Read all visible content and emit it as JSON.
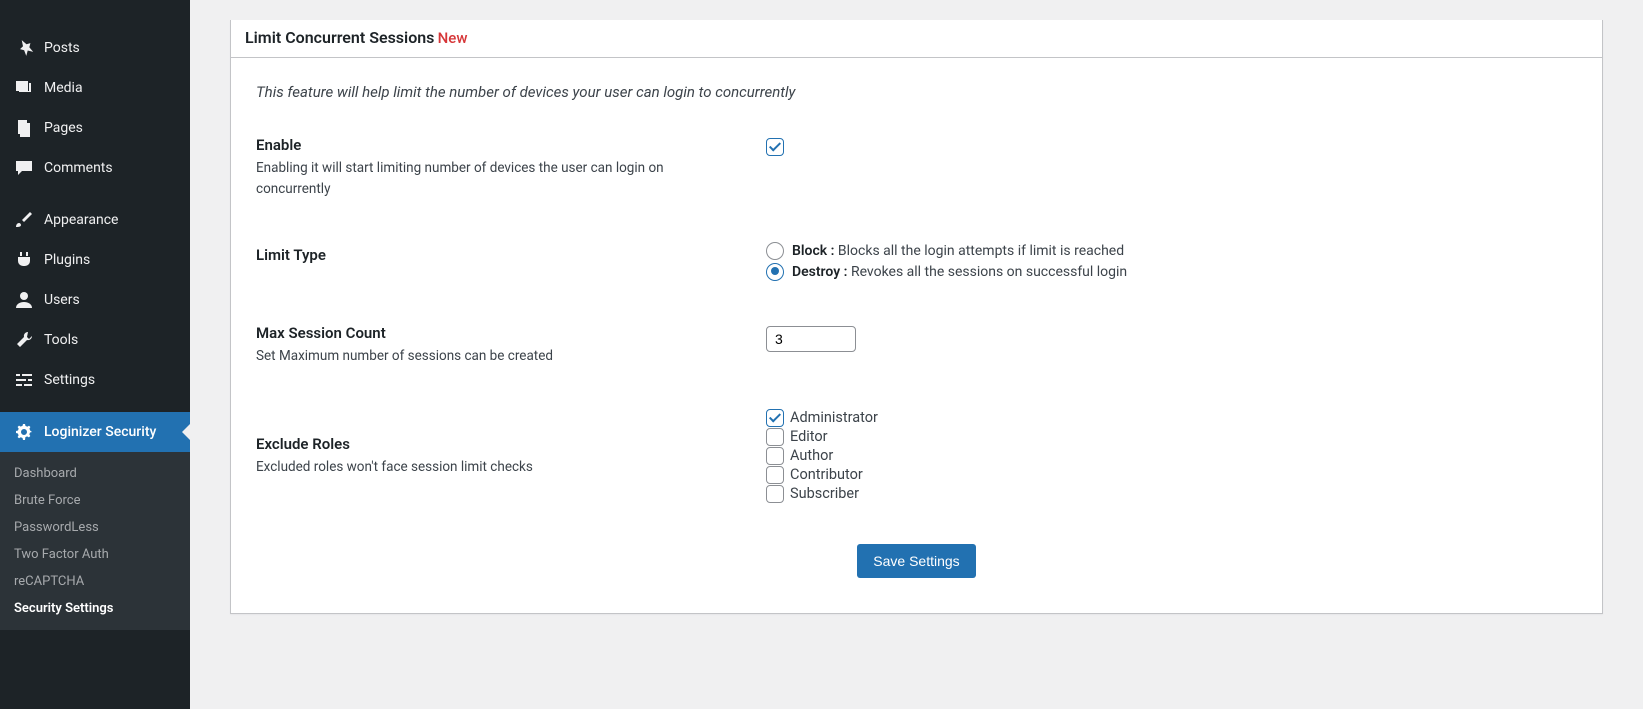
{
  "sidebar": {
    "items": [
      {
        "label": "Posts",
        "icon": "pin"
      },
      {
        "label": "Media",
        "icon": "media"
      },
      {
        "label": "Pages",
        "icon": "pages"
      },
      {
        "label": "Comments",
        "icon": "comment"
      },
      {
        "label": "Appearance",
        "icon": "brush"
      },
      {
        "label": "Plugins",
        "icon": "plug"
      },
      {
        "label": "Users",
        "icon": "user"
      },
      {
        "label": "Tools",
        "icon": "wrench"
      },
      {
        "label": "Settings",
        "icon": "sliders"
      },
      {
        "label": "Loginizer Security",
        "icon": "gear",
        "active": true
      }
    ],
    "submenu": [
      {
        "label": "Dashboard"
      },
      {
        "label": "Brute Force"
      },
      {
        "label": "PasswordLess"
      },
      {
        "label": "Two Factor Auth"
      },
      {
        "label": "reCAPTCHA"
      },
      {
        "label": "Security Settings",
        "current": true
      }
    ]
  },
  "panel": {
    "title": "Limit Concurrent Sessions",
    "tag": "New",
    "description": "This feature will help limit the number of devices your user can login to concurrently",
    "enable": {
      "label": "Enable",
      "desc": "Enabling it will start limiting number of devices the user can login on concurrently",
      "checked": true
    },
    "limit_type": {
      "label": "Limit Type",
      "options": [
        {
          "name": "Block :",
          "text": " Blocks all the login attempts if limit is reached",
          "checked": false
        },
        {
          "name": "Destroy :",
          "text": " Revokes all the sessions on successful login",
          "checked": true
        }
      ]
    },
    "max_count": {
      "label": "Max Session Count",
      "desc": "Set Maximum number of sessions can be created",
      "value": "3"
    },
    "exclude_roles": {
      "label": "Exclude Roles",
      "desc": "Excluded roles won't face session limit checks",
      "roles": [
        {
          "name": "Administrator",
          "checked": true
        },
        {
          "name": "Editor",
          "checked": false
        },
        {
          "name": "Author",
          "checked": false
        },
        {
          "name": "Contributor",
          "checked": false
        },
        {
          "name": "Subscriber",
          "checked": false
        }
      ]
    },
    "save": "Save Settings"
  }
}
